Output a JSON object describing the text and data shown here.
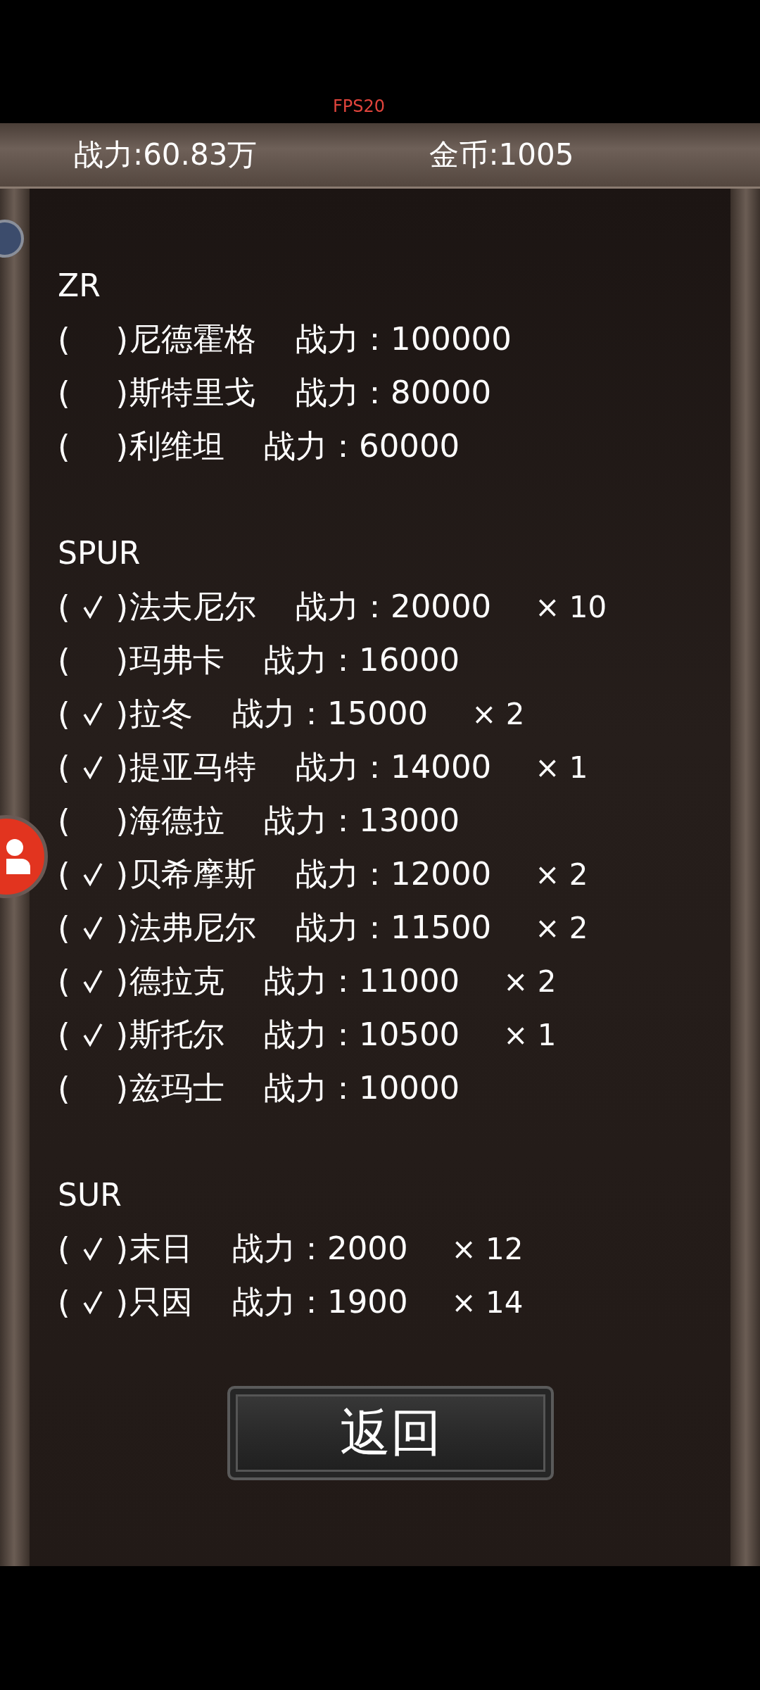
{
  "fps": "FPS20",
  "header": {
    "power": "战力:60.83万",
    "gold": "金币:1005"
  },
  "groups": [
    {
      "title": "ZR",
      "rows": [
        {
          "brackets": [
            "(",
            ")"
          ],
          "checked": false,
          "name": "尼德霍格",
          "power": "战力：100000"
        },
        {
          "brackets": [
            "(",
            ")"
          ],
          "checked": false,
          "name": "斯特里戈",
          "power": "战力：80000"
        },
        {
          "brackets": [
            "(",
            ")"
          ],
          "checked": false,
          "name": "利维坦",
          "power": "战力：60000"
        }
      ]
    },
    {
      "title": "SPUR",
      "rows": [
        {
          "brackets": [
            "(",
            ")"
          ],
          "checked": true,
          "name": "法夫尼尔",
          "power": "战力：20000",
          "count": "× 10"
        },
        {
          "brackets": [
            "(",
            ")"
          ],
          "checked": false,
          "name": "玛弗卡",
          "power": "战力：16000"
        },
        {
          "brackets": [
            "(",
            ")"
          ],
          "checked": true,
          "name": "拉冬",
          "power": "战力：15000",
          "count": "× 2"
        },
        {
          "brackets": [
            "(",
            ")"
          ],
          "checked": true,
          "name": "提亚马特",
          "power": "战力：14000",
          "count": "× 1"
        },
        {
          "brackets": [
            "(",
            ")"
          ],
          "checked": false,
          "name": "海德拉",
          "power": "战力：13000"
        },
        {
          "brackets": [
            "(",
            ")"
          ],
          "checked": true,
          "name": "贝希摩斯",
          "power": "战力：12000",
          "count": "× 2"
        },
        {
          "brackets": [
            "(",
            ")"
          ],
          "checked": true,
          "name": "法弗尼尔",
          "power": "战力：11500",
          "count": "× 2"
        },
        {
          "brackets": [
            "(",
            ")"
          ],
          "checked": true,
          "name": "德拉克",
          "power": "战力：11000",
          "count": "× 2"
        },
        {
          "brackets": [
            "(",
            ")"
          ],
          "checked": true,
          "name": "斯托尔",
          "power": "战力：10500",
          "count": "× 1"
        },
        {
          "brackets": [
            "(",
            ")"
          ],
          "checked": false,
          "name": "兹玛士",
          "power": "战力：10000"
        }
      ]
    },
    {
      "title": "SUR",
      "rows": [
        {
          "brackets": [
            "(",
            ")"
          ],
          "checked": true,
          "name": "末日",
          "power": "战力：2000",
          "count": "× 12"
        },
        {
          "brackets": [
            "(",
            ")"
          ],
          "checked": true,
          "name": "只因",
          "power": "战力：1900",
          "count": "× 14"
        }
      ]
    }
  ],
  "back_button": "返回"
}
